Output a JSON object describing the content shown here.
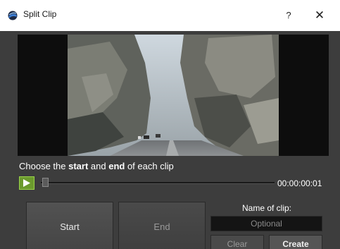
{
  "window": {
    "title": "Split Clip",
    "app_icon": "app-icon",
    "help_label": "?",
    "close_label": "✕"
  },
  "preview": {
    "thumbnail": "video-frame-canyon-road"
  },
  "instructions": {
    "part1": "Choose the ",
    "bold1": "start",
    "part2": " and ",
    "bold2": "end",
    "part3": " of each clip"
  },
  "playback": {
    "play_icon": "play-icon",
    "timecode": "00:00:00:01",
    "position": 0.0
  },
  "buttons": {
    "start_label": "Start",
    "end_label": "End",
    "clear_label": "Clear",
    "create_label": "Create"
  },
  "name_field": {
    "label": "Name of clip:",
    "placeholder": "Optional",
    "value": ""
  },
  "colors": {
    "accent_play": "#6c9a2e",
    "background": "#3d3d3d",
    "preview_bg": "#0d0d0d"
  }
}
